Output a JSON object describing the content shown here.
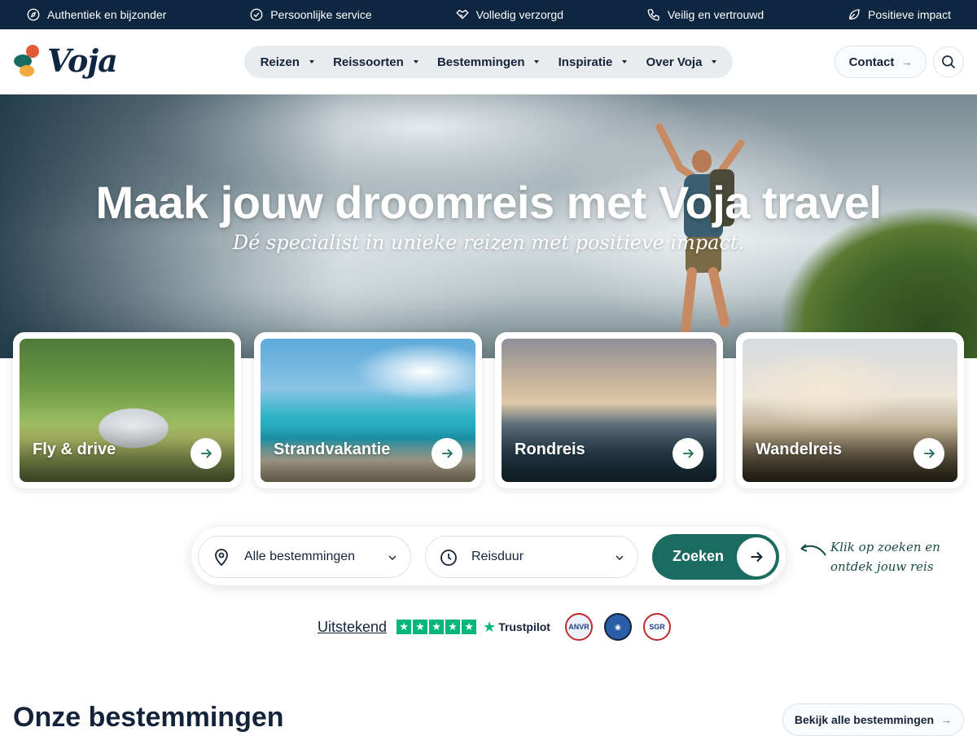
{
  "topbar": {
    "items": [
      {
        "label": "Authentiek en bijzonder",
        "icon": "compass-icon"
      },
      {
        "label": "Persoonlijke service",
        "icon": "check-circle-icon"
      },
      {
        "label": "Volledig verzorgd",
        "icon": "handshake-icon"
      },
      {
        "label": "Veilig en vertrouwd",
        "icon": "phone-icon"
      },
      {
        "label": "Positieve impact",
        "icon": "leaf-icon"
      }
    ]
  },
  "header": {
    "logo_text": "Voja",
    "nav": [
      {
        "label": "Reizen"
      },
      {
        "label": "Reissoorten"
      },
      {
        "label": "Bestemmingen"
      },
      {
        "label": "Inspiratie"
      },
      {
        "label": "Over Voja"
      }
    ],
    "contact_label": "Contact"
  },
  "hero": {
    "title": "Maak jouw droomreis met Voja travel",
    "subtitle": "Dé specialist in unieke reizen met positieve impact."
  },
  "cards": [
    {
      "label": "Fly & drive"
    },
    {
      "label": "Strandvakantie"
    },
    {
      "label": "Rondreis"
    },
    {
      "label": "Wandelreis"
    }
  ],
  "search": {
    "destination_value": "Alle bestemmingen",
    "duration_value": "Reisduur",
    "submit_label": "Zoeken",
    "hint_line1": "Klik op zoeken en",
    "hint_line2": "ontdek jouw reis"
  },
  "trust": {
    "rating_label": "Uitstekend",
    "provider": "Trustpilot",
    "stars": 5,
    "badges": [
      "ANVR",
      "SGR"
    ]
  },
  "destinations": {
    "title": "Onze bestemmingen",
    "all_label": "Bekijk alle bestemmingen"
  },
  "colors": {
    "navy": "#0f2640",
    "teal": "#1a6b60",
    "trustpilot_green": "#00b67a"
  }
}
